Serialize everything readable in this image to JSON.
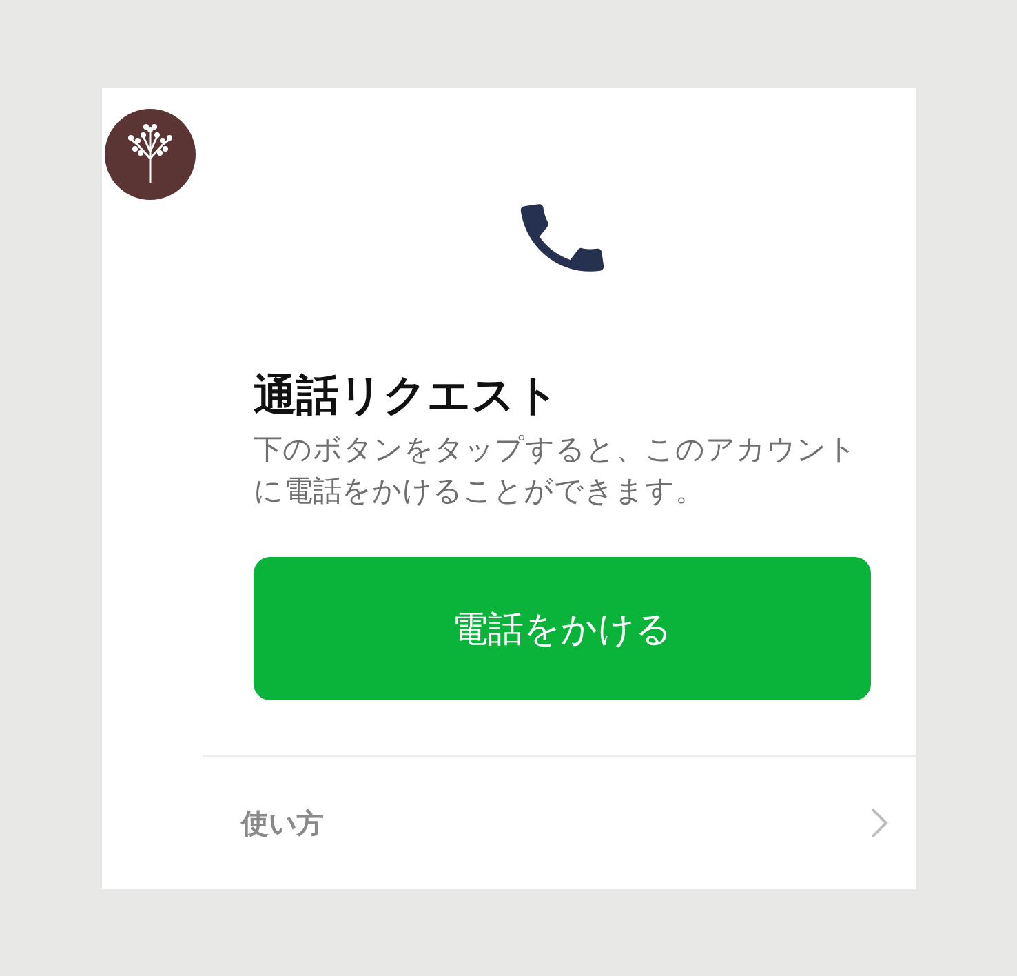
{
  "title": "通話リクエスト",
  "description": "下のボタンをタップすると、このアカウントに電話をかけることができます。",
  "call_button": {
    "label": "電話をかける"
  },
  "help_row": {
    "label": "使い方"
  }
}
